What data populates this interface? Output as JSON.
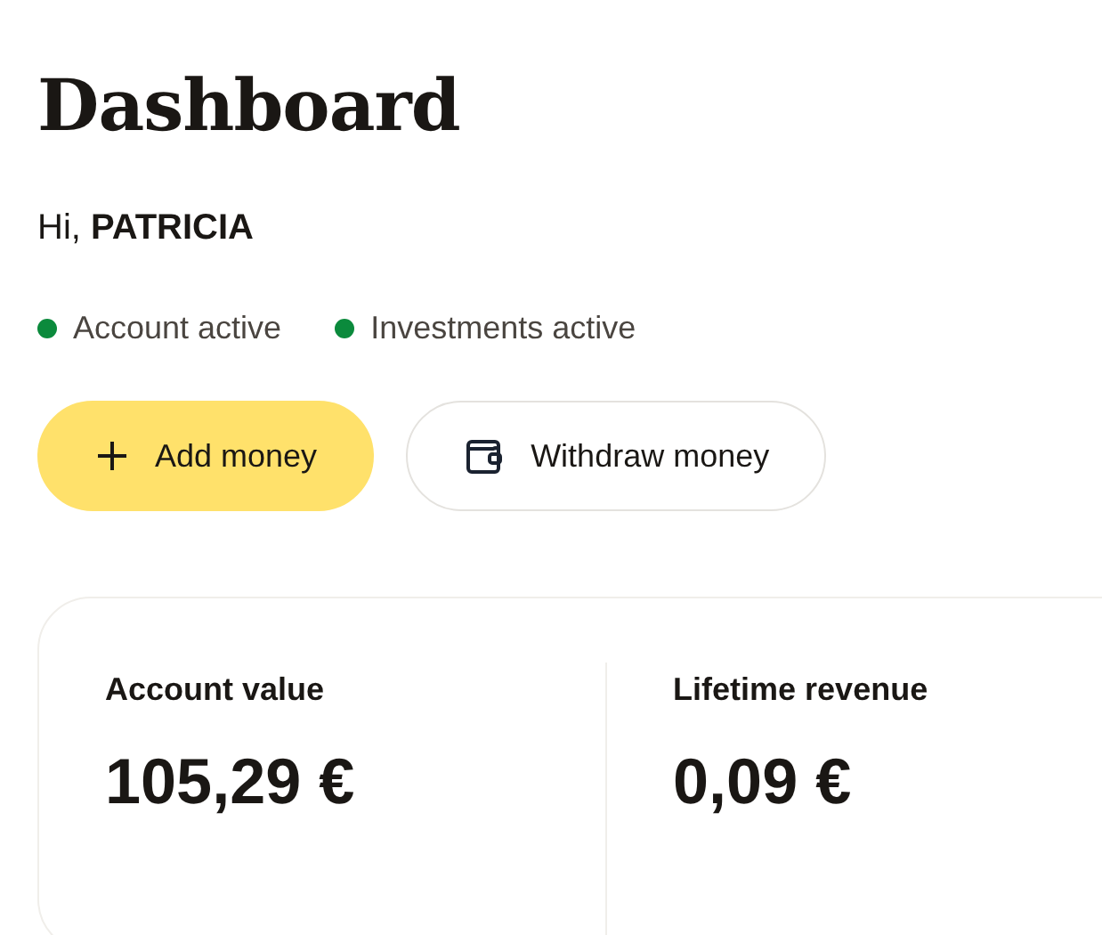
{
  "page": {
    "title": "Dashboard"
  },
  "greeting": "Hi, **PATRICIA**",
  "statuses": [
    {
      "label": "Account active",
      "color": "#0b8a3c"
    },
    {
      "label": "Investments active",
      "color": "#0b8a3c"
    }
  ],
  "actions": [
    {
      "label": "Add money",
      "kind": "primary"
    },
    {
      "label": "Withdraw money",
      "kind": "secondary"
    }
  ],
  "stats": [
    {
      "label": "Account value",
      "value": "105,29 €"
    },
    {
      "label": "Lifetime revenue",
      "value": "0,09 €"
    }
  ]
}
